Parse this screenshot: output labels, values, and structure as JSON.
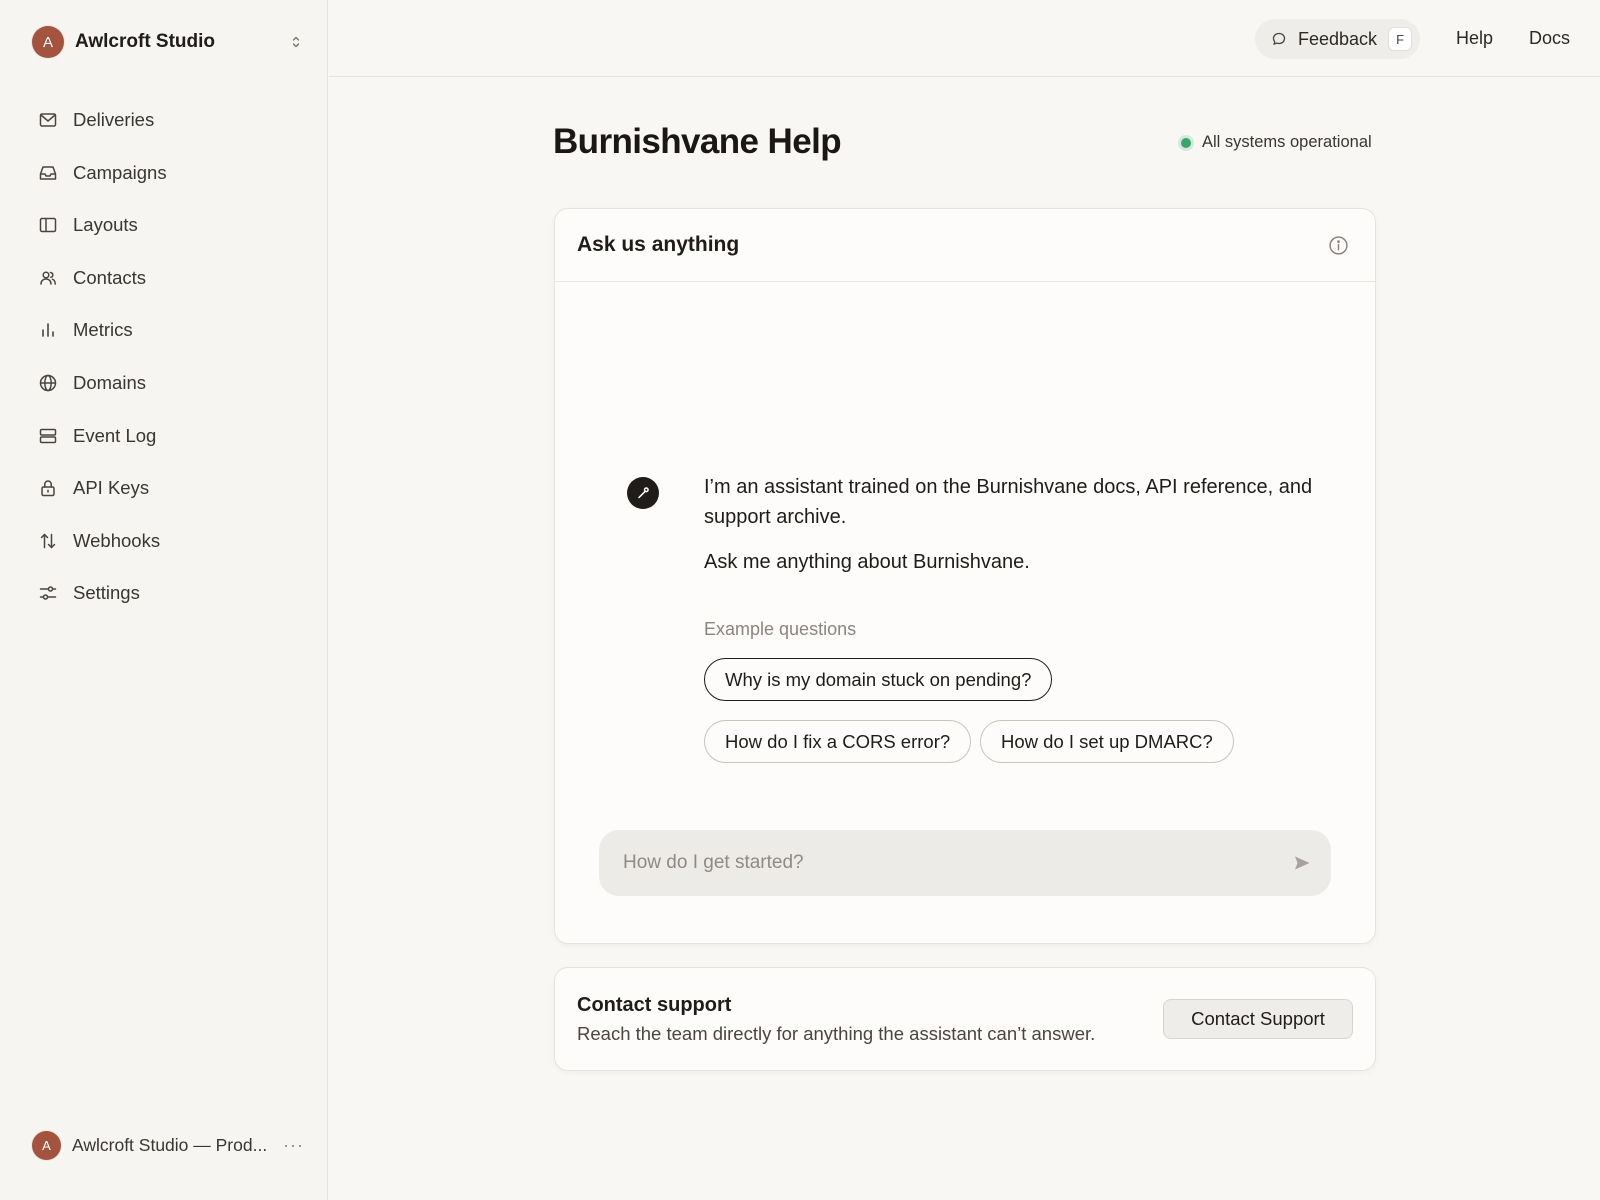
{
  "workspace": {
    "initial": "A",
    "name": "Awlcroft Studio"
  },
  "sidebar": {
    "items": [
      {
        "label": "Deliveries",
        "icon": "mail-icon"
      },
      {
        "label": "Campaigns",
        "icon": "inbox-icon"
      },
      {
        "label": "Layouts",
        "icon": "layout-icon"
      },
      {
        "label": "Contacts",
        "icon": "users-icon"
      },
      {
        "label": "Metrics",
        "icon": "bar-chart-icon"
      },
      {
        "label": "Domains",
        "icon": "globe-icon"
      },
      {
        "label": "Event Log",
        "icon": "server-icon"
      },
      {
        "label": "API Keys",
        "icon": "lock-icon"
      },
      {
        "label": "Webhooks",
        "icon": "arrows-up-down-icon"
      },
      {
        "label": "Settings",
        "icon": "sliders-icon"
      }
    ]
  },
  "account": {
    "initial": "A",
    "name": "Awlcroft Studio — Prod...",
    "more": "···"
  },
  "topbar": {
    "feedback_label": "Feedback",
    "feedback_shortcut": "F",
    "help": "Help",
    "docs": "Docs"
  },
  "page": {
    "title": "Burnishvane Help",
    "status": "All systems operational",
    "status_color": "#3aa56a"
  },
  "chat": {
    "title": "Ask us anything",
    "intro": "I’m an assistant trained on the Burnishvane docs, API reference, and support archive.",
    "prompt": "Ask me anything about Burnishvane.",
    "examples_label": "Example questions",
    "examples": [
      "Why is my domain stuck on pending?",
      "How do I fix a CORS error?",
      "How do I set up DMARC?"
    ],
    "input_placeholder": "How do I get started?",
    "input_value": ""
  },
  "support": {
    "title": "Contact support",
    "description": "Reach the team directly for anything the assistant can’t answer.",
    "button": "Contact Support"
  }
}
